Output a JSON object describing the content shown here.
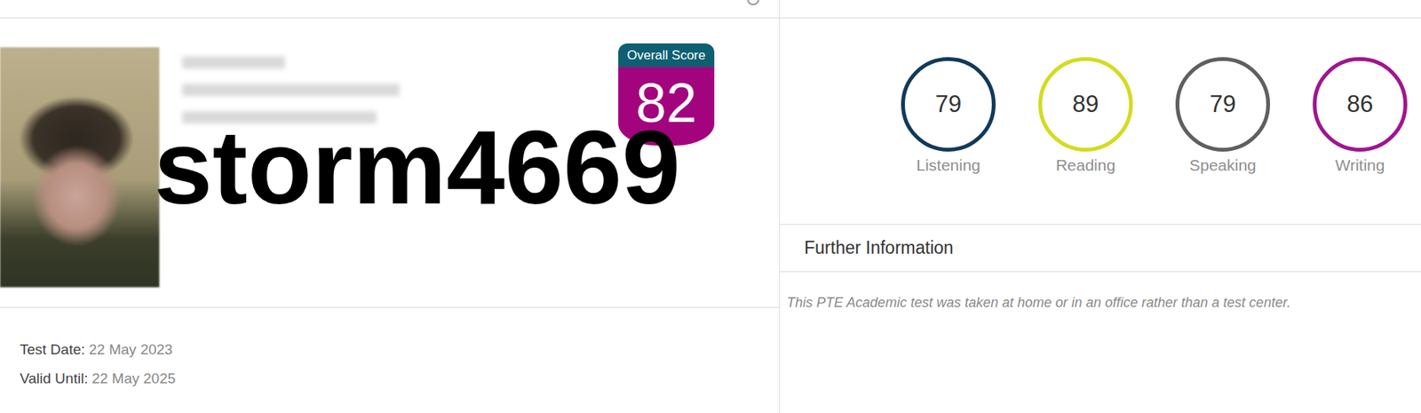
{
  "overall": {
    "label": "Overall Score",
    "score": "82"
  },
  "watermark": "storm4669",
  "scores": [
    {
      "label": "Listening",
      "score": "79",
      "color": "#12395b"
    },
    {
      "label": "Reading",
      "score": "89",
      "color": "#d3dc1f"
    },
    {
      "label": "Speaking",
      "score": "79",
      "color": "#5f5f5f"
    },
    {
      "label": "Writing",
      "score": "86",
      "color": "#a0168c"
    }
  ],
  "further_information": {
    "title": "Further Information",
    "note": "This PTE Academic test was taken at home or in an office rather than a test center."
  },
  "dates": [
    {
      "label": "Test Date:",
      "value": "22 May 2023"
    },
    {
      "label": "Valid Until:",
      "value": "22 May 2025"
    }
  ]
}
